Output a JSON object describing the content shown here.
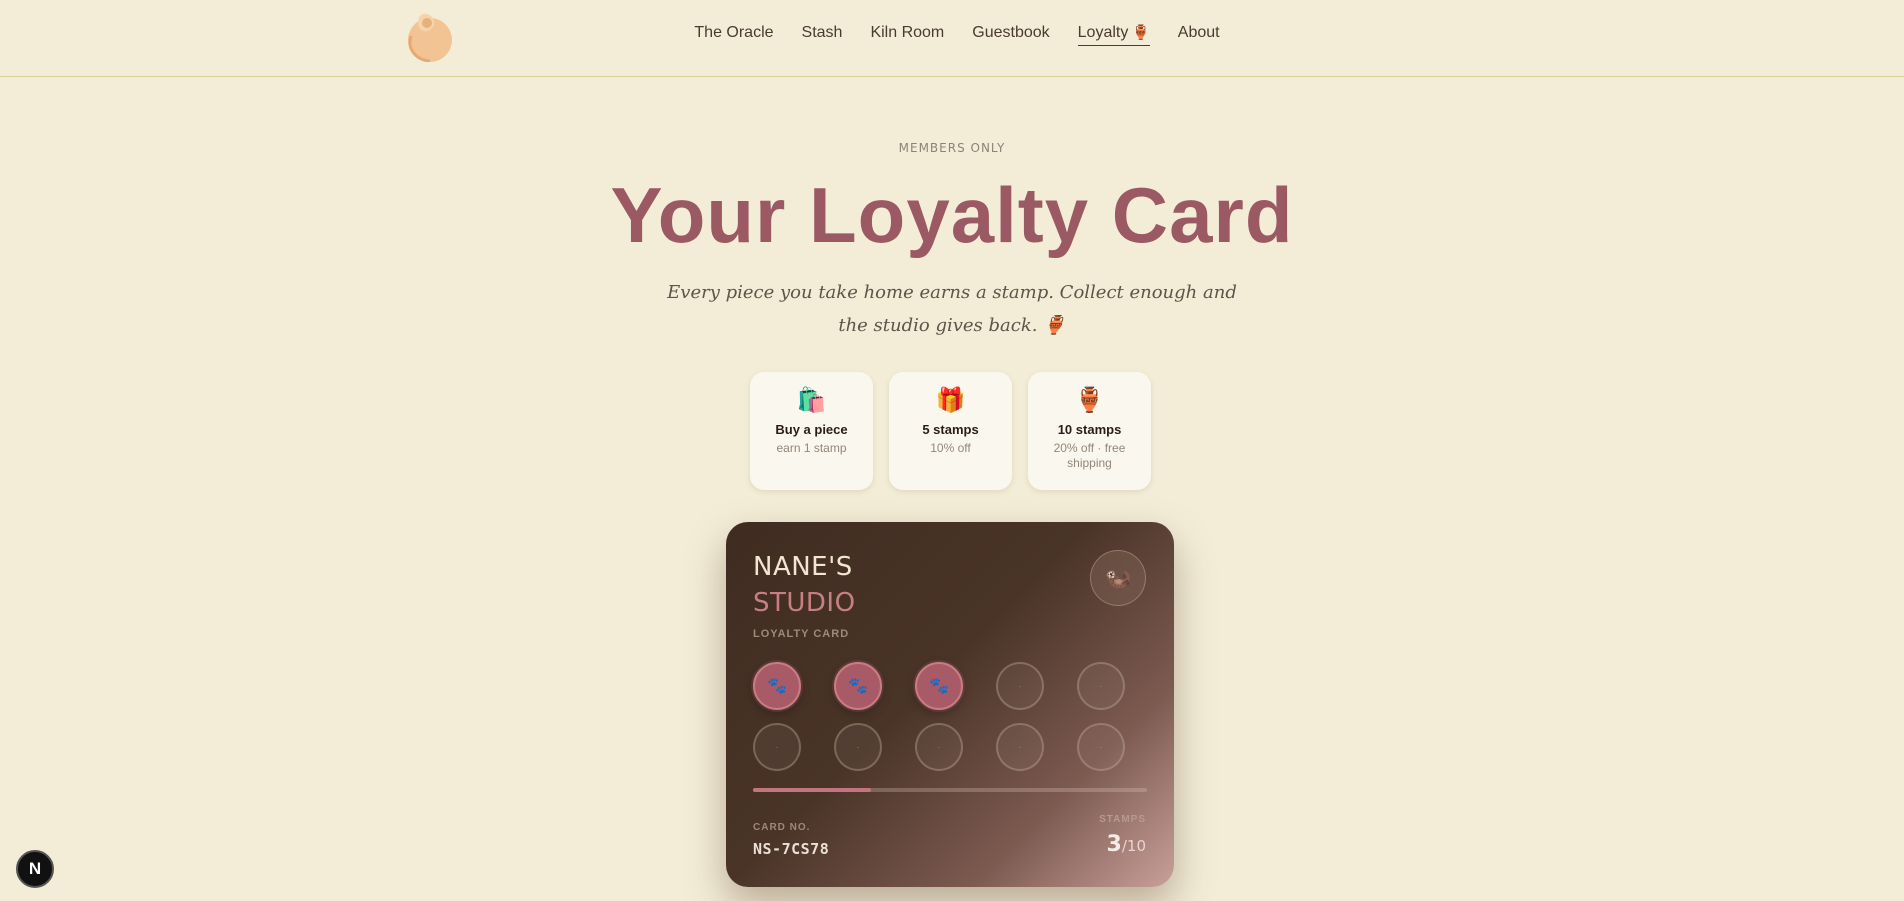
{
  "nav": {
    "items": [
      {
        "label": "The Oracle"
      },
      {
        "label": "Stash"
      },
      {
        "label": "Kiln Room"
      },
      {
        "label": "Guestbook"
      },
      {
        "label": "Loyalty",
        "emoji": "🏺",
        "active": true
      },
      {
        "label": "About"
      }
    ]
  },
  "hero": {
    "eyebrow": "MEMBERS ONLY",
    "title": "Your Loyalty Card",
    "subtitle_line1": "Every piece you take home earns a stamp. Collect enough and",
    "subtitle_line2": "the studio gives back. 🏺"
  },
  "tiles": [
    {
      "icon": "🛍️",
      "title": "Buy a piece",
      "subtitle": "earn 1 stamp"
    },
    {
      "icon": "🎁",
      "title": "5 stamps",
      "subtitle": "10% off"
    },
    {
      "icon": "🏺",
      "title": "10 stamps",
      "subtitle": "20% off · free shipping"
    }
  ],
  "card": {
    "brand_line1": "NANE'S",
    "brand_line2": "STUDIO",
    "label": "LOYALTY CARD",
    "avatar": "🦦",
    "stamp_icon": "🐾",
    "empty_mark": "·",
    "stamps_collected": 3,
    "stamps_total": 10,
    "progress_fraction": 0.3,
    "card_no_label": "CARD NO.",
    "card_no": "NS-7CS78",
    "stamps_label": "STAMPS",
    "stamps_value": "3",
    "stamps_total_text": "/10"
  },
  "badge": {
    "letter": "N"
  },
  "colors": {
    "background": "#f3edd7",
    "accent": "#9b5963",
    "stamp_on": "#a85a66"
  }
}
